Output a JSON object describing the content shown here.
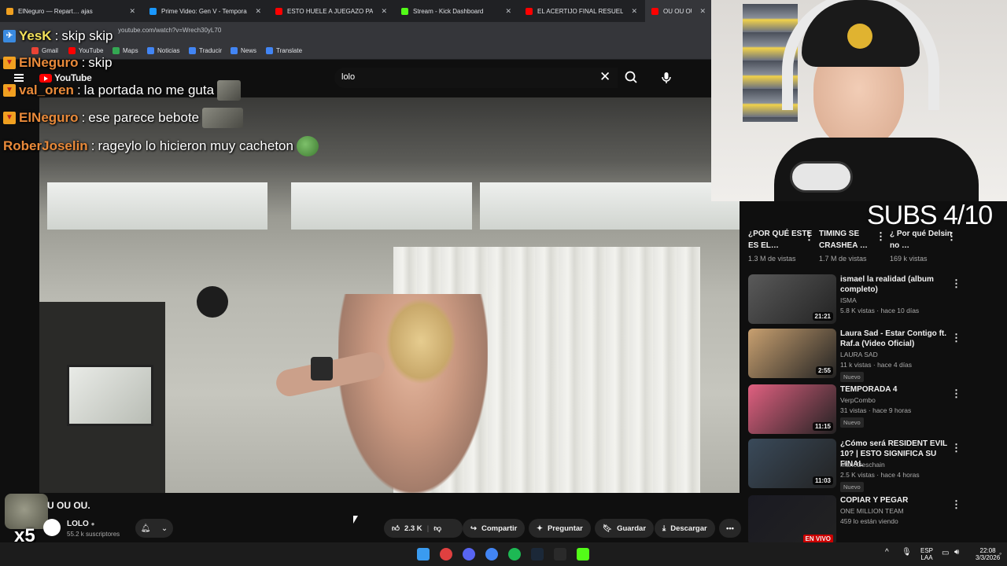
{
  "browser": {
    "tabs": [
      {
        "title": "ElNegurо — Repart… ajas",
        "color": "#f0a020"
      },
      {
        "title": "Prime Video: Gen V - Temporada",
        "color": "#1a98ff"
      },
      {
        "title": "ESTO HUELE A JUEGAZO PARA",
        "color": "#ff0000"
      },
      {
        "title": "Stream - Kick Dashboard",
        "color": "#53fc18"
      },
      {
        "title": "EL ACERTIJO FINAL RESUELTO y",
        "color": "#ff0000"
      },
      {
        "title": "OU OU OU. - You",
        "color": "#ff0000"
      }
    ],
    "url": "youtube.com/watch?v=Wrech30yL70",
    "bookmarks": [
      {
        "label": "Gmail",
        "color": "#ea4335"
      },
      {
        "label": "YouTube",
        "color": "#ff0000"
      },
      {
        "label": "Maps",
        "color": "#34a853"
      },
      {
        "label": "Noticias",
        "color": "#4285f4"
      },
      {
        "label": "Traducir",
        "color": "#4285f4"
      },
      {
        "label": "News",
        "color": "#4285f4"
      },
      {
        "label": "Translate",
        "color": "#4285f4"
      }
    ]
  },
  "youtube": {
    "logo": "YouTube",
    "search_value": "lolo"
  },
  "chat": [
    {
      "user": "YesK",
      "message": "skip skip",
      "user_color": "#f2e15a"
    },
    {
      "user": "ElNegurо",
      "message": "skip",
      "user_color": "#e98a3a"
    },
    {
      "user": "val_oren",
      "message": "la portada no me guta",
      "user_color": "#e98a3a"
    },
    {
      "user": "ElNegurо",
      "message": "ese parece bebote",
      "user_color": "#e98a3a"
    },
    {
      "user": "RoberJoselin",
      "message": "rageylo lo hicieron muy cacheton",
      "user_color": "#e98a3a"
    }
  ],
  "overlay": {
    "subs_goal": "SUBS 4/10",
    "multiplier": "x5"
  },
  "video": {
    "title": "U OU OU.",
    "channel": "LOLO",
    "subscribers": "55.2 k suscriptores",
    "likes": "2.3 K",
    "share": "Compartir",
    "ask": "Preguntar",
    "save": "Guardar",
    "download": "Descargar"
  },
  "sidebar_top": [
    {
      "title": "¿POR QUÉ ESTE ES EL…",
      "views": "1.3 M de vistas"
    },
    {
      "title": "TIMING SE CRASHEA …",
      "views": "1.7 M de vistas"
    },
    {
      "title": "¿ Por qué Delsin no …",
      "views": "169 k vistas"
    }
  ],
  "sidebar": [
    {
      "title": "ismael la realidad (album completo)",
      "channel": "ISMA",
      "meta": "5.8 K vistas · hace 10 días",
      "duration": "21:21",
      "new": "",
      "thumb": "#5a5a5a"
    },
    {
      "title": "Laura Sad - Estar Contigo ft. Raf.a (Video Oficial)",
      "channel": "LAURA SAD",
      "meta": "11 k vistas · hace 4 días",
      "duration": "2:55",
      "new": "Nuevo",
      "thumb": "#c8a070"
    },
    {
      "title": "TEMPORADA 4",
      "channel": "VerpCombo",
      "meta": "31 vistas · hace 9 horas",
      "duration": "11:15",
      "new": "Nuevo",
      "thumb": "#e06080"
    },
    {
      "title": "¿Cómo será RESIDENT EVIL 10? | ESTO SIGNIFICA SU FINAL",
      "channel": "MarioDeschain",
      "meta": "2.5 K vistas · hace 4 horas",
      "duration": "11:03",
      "new": "Nuevo",
      "thumb": "#3a4a5a"
    },
    {
      "title": "COPIAR Y PEGAR",
      "channel": "ONE MILLION TEAM",
      "meta": "459 lo están viendo",
      "duration": "",
      "new": "",
      "live": "EN VIVO",
      "thumb": "#1a1a22"
    }
  ],
  "taskbar": {
    "icons": [
      "windows",
      "chrome-alt",
      "discord",
      "chrome",
      "spotify",
      "steam",
      "epic",
      "kick"
    ],
    "lang": "ESP",
    "lang2": "LAA",
    "time": "22:08",
    "date": "3/3/2026"
  }
}
